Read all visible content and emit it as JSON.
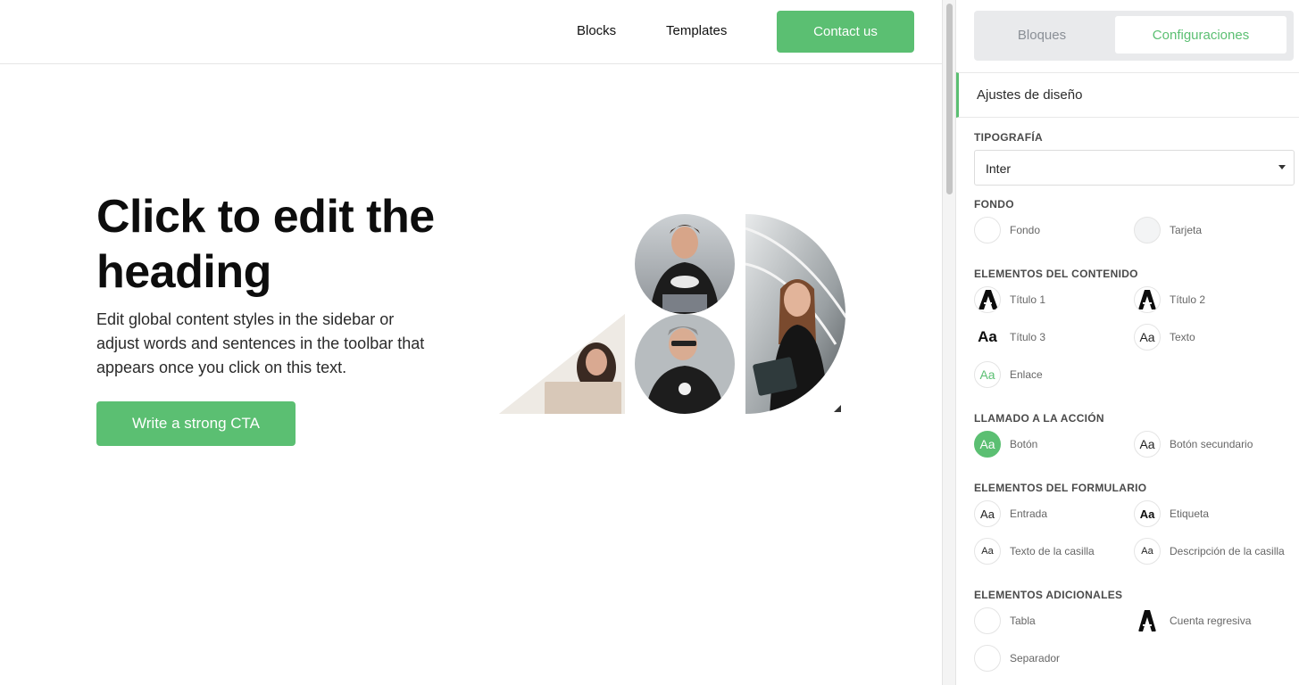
{
  "nav": {
    "blocks": "Blocks",
    "templates": "Templates",
    "contact": "Contact us"
  },
  "hero": {
    "heading": "Click to edit the heading",
    "subtext": "Edit global content styles in the sidebar or adjust words and sentences in the toolbar that appears once you click on this text.",
    "cta": "Write a strong CTA"
  },
  "sidebar": {
    "tabs": [
      "Bloques",
      "Configuraciones"
    ],
    "section_title": "Ajustes de diseño",
    "typography": {
      "title": "TIPOGRAFÍA",
      "value": "Inter"
    },
    "background": {
      "title": "FONDO",
      "items": [
        "Fondo",
        "Tarjeta"
      ]
    },
    "content": {
      "title": "ELEMENTOS DEL CONTENIDO",
      "items": [
        "Título 1",
        "Título 2",
        "Título 3",
        "Texto",
        "Enlace"
      ]
    },
    "cta": {
      "title": "LLAMADO A LA ACCIÓN",
      "items": [
        "Botón",
        "Botón secundario"
      ]
    },
    "form": {
      "title": "ELEMENTOS DEL FORMULARIO",
      "items": [
        "Entrada",
        "Etiqueta",
        "Texto de la casilla",
        "Descripción de la casilla"
      ]
    },
    "additional": {
      "title": "ELEMENTOS ADICIONALES",
      "items": [
        "Tabla",
        "Cuenta regresiva",
        "Separador"
      ]
    },
    "glyph": "Aa"
  },
  "colors": {
    "accent": "#5bbf72",
    "card_swatch": "#f3f4f5",
    "divider": "#e6e6e6"
  }
}
